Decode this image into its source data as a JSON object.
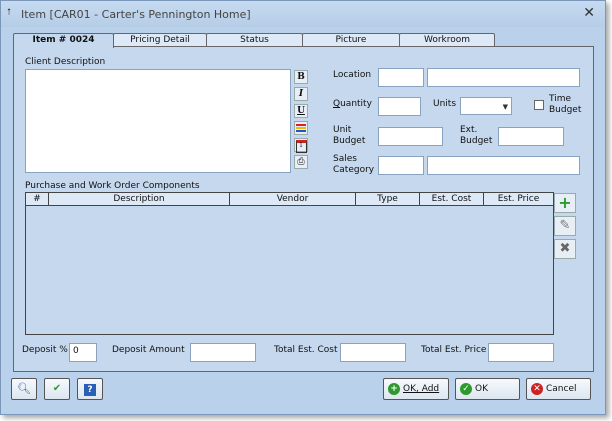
{
  "window": {
    "title": "Item [CAR01 - Carter's Pennington Home]"
  },
  "tabs": [
    {
      "label": "Item # 0024",
      "active": true
    },
    {
      "label": "Pricing Detail"
    },
    {
      "label": "Status"
    },
    {
      "label": "Picture"
    },
    {
      "label": "Workroom"
    }
  ],
  "client": {
    "label": "Client Description",
    "value": ""
  },
  "fields": {
    "location_label": "Location",
    "quantity_label": "Quantity",
    "units_label": "Units",
    "time_budget_label_1": "Time",
    "time_budget_label_2": "Budget",
    "unit_budget_label_1": "Unit",
    "unit_budget_label_2": "Budget",
    "ext_budget_label_1": "Ext.",
    "ext_budget_label_2": "Budget",
    "sales_category_label_1": "Sales",
    "sales_category_label_2": "Category"
  },
  "components": {
    "title": "Purchase and Work Order Components",
    "columns": [
      "#",
      "Description",
      "Vendor",
      "Type",
      "Est. Cost",
      "Est. Price"
    ]
  },
  "totals": {
    "deposit_pct_label": "Deposit %",
    "deposit_pct_value": "0",
    "deposit_amount_label": "Deposit Amount",
    "total_est_cost_label": "Total Est. Cost",
    "total_est_price_label": "Total Est. Price"
  },
  "buttons": {
    "ok_add": "OK, Add",
    "ok": "OK",
    "cancel": "Cancel"
  },
  "icons": {
    "format": [
      "bold-icon",
      "italic-icon",
      "underline-icon",
      "color-icon",
      "calendar-icon",
      "print-icon"
    ],
    "side": [
      "add-icon",
      "edit-icon",
      "delete-icon"
    ],
    "footer": [
      "search-icon",
      "spellcheck-icon",
      "help-icon"
    ]
  },
  "colors": {
    "accent_green": "#2e9a2e",
    "cancel_red": "#cc2222",
    "window_bg": "#b9d1ea"
  }
}
